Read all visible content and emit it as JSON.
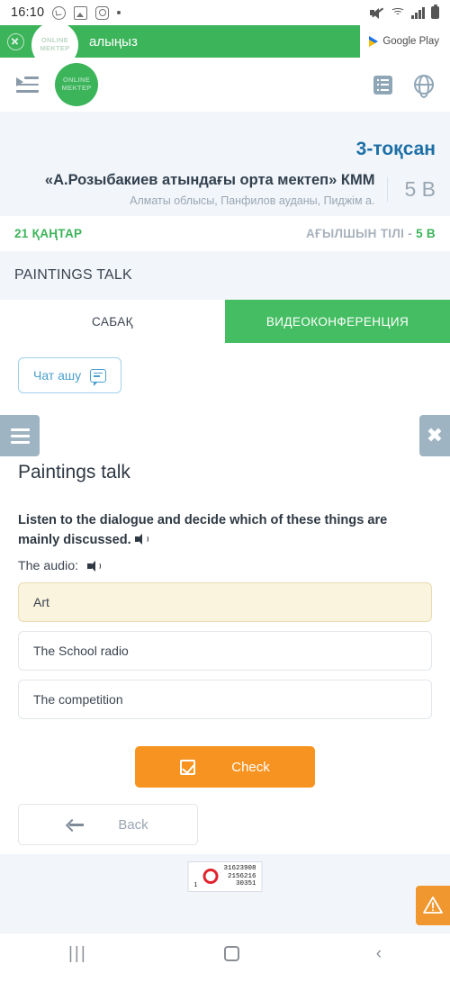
{
  "statusbar": {
    "time": "16:10",
    "icons": [
      "whatsapp-icon",
      "photos-icon",
      "instagram-icon",
      "dot-indicator"
    ],
    "right_icons": [
      "mute-icon",
      "wifi-icon",
      "signal-icon",
      "battery-icon"
    ]
  },
  "app_banner": {
    "logo_line1": "ONLINE",
    "logo_line2": "MEKTEP",
    "text": "алыңыз",
    "install_label": "Google Play",
    "close_icon": "close-circle-icon",
    "background": "#3cb45a"
  },
  "site_header": {
    "logo_line1": "ONLINE",
    "logo_line2": "MEKTEP",
    "toggle_icon": "sidebar-toggle-icon",
    "list_icon": "list-icon",
    "globe_icon": "globe-icon"
  },
  "lesson_header": {
    "cut_text": "-",
    "quarter": "3-тоқсан",
    "school_name": "«А.Розыбакиев атындағы орта мектеп» КММ",
    "school_address": "Алматы облысы, Панфилов ауданы, Пиджім а.",
    "grade": "5 В",
    "date": "21 ҚАҢТАР",
    "subject_prefix": "АҒЫЛШЫН ТІЛІ - ",
    "subject_grade": "5 В",
    "lesson_title": "PAINTINGS TALK",
    "quarter_color": "#1d6fa5",
    "date_color": "#3cb45a"
  },
  "tabs": [
    {
      "label": "САБАҚ",
      "active": false
    },
    {
      "label": "ВИДЕОКОНФЕРЕНЦИЯ",
      "active": true
    }
  ],
  "chat_button": {
    "label": "Чат ашу",
    "icon": "chat-bubble-icon"
  },
  "exercise": {
    "menu_icon": "hamburger-menu-icon",
    "close_icon": "close-icon",
    "title": "Paintings talk",
    "question": "Listen to the dialogue and decide which of these things are mainly discussed.",
    "question_audio_icon": "speaker-icon",
    "audio_label": "The audio:",
    "audio_icon": "speaker-icon",
    "options": [
      {
        "label": "Art",
        "selected": true
      },
      {
        "label": "The School radio",
        "selected": false
      },
      {
        "label": "The competition",
        "selected": false
      }
    ],
    "check_button": {
      "label": "Check",
      "icon": "checkbox-icon",
      "color": "#f79421"
    },
    "back_button": {
      "label": "Back",
      "icon": "arrow-left-icon"
    }
  },
  "footer": {
    "counter": {
      "rank": "1",
      "line1": "31623908",
      "line2": "2156216",
      "line3": "30351",
      "icon": "liveinternet-ring-icon"
    },
    "warning_fab": {
      "icon": "warning-triangle-icon",
      "color": "#f0982f"
    }
  },
  "navbar": {
    "recents": "|||",
    "home_icon": "home-icon",
    "back": "‹"
  }
}
